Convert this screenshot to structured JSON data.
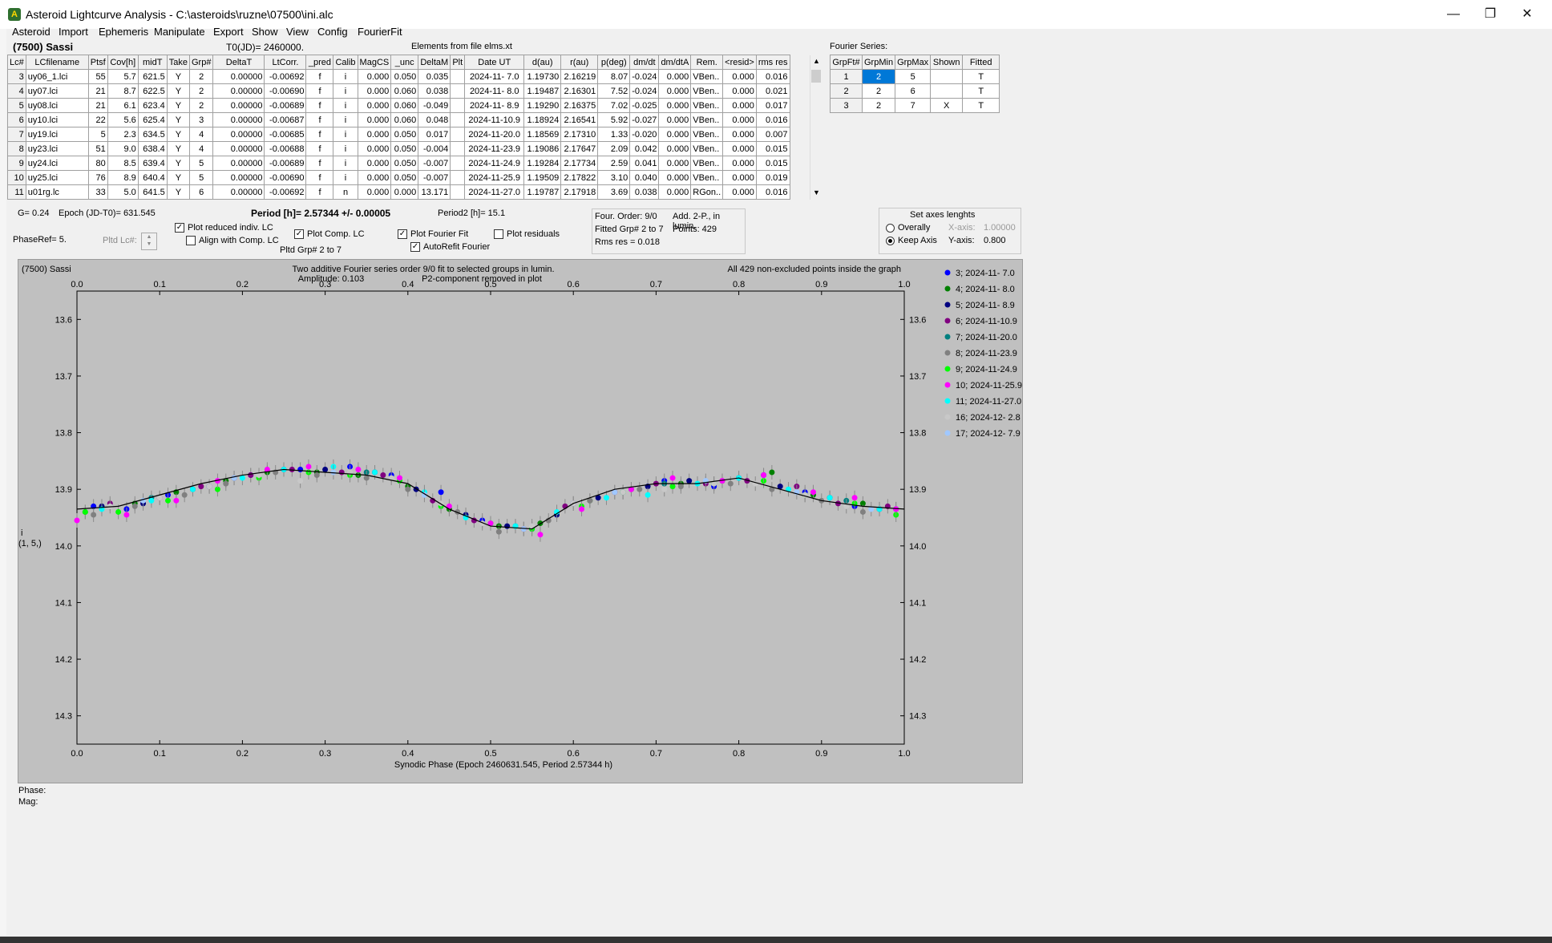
{
  "window": {
    "title": "Asteroid Lightcurve Analysis - C:\\asteroids\\ruzne\\07500\\ini.alc",
    "minimize": "—",
    "restore": "❐",
    "close": "✕"
  },
  "menu": [
    "Asteroid",
    "Import",
    "Ephemeris",
    "Manipulate",
    "Export",
    "Show",
    "View",
    "Config",
    "FourierFit"
  ],
  "header": {
    "asteroid": "(7500) Sassi",
    "t0": "T0(JD)= 2460000.",
    "elements": "Elements from file elms.xt",
    "fourier_series_label": "Fourier Series:"
  },
  "lc_table": {
    "columns": [
      "Lc#",
      "LCfilename",
      "Ptsf",
      "Cov[h]",
      "midT",
      "Take",
      "Grp#",
      "DeltaT",
      "LtCorr.",
      "_pred",
      "Calib",
      "MagCS",
      "_unc",
      "DeltaM",
      "Plt",
      "Date UT",
      "d(au)",
      "r(au)",
      "p(deg)",
      "dm/dt",
      "dm/dtA",
      "Rem.",
      "<resid>",
      "rms res"
    ],
    "rows": [
      [
        "3",
        "uy06_1.lci",
        "55",
        "5.7",
        "621.5",
        "Y",
        "2",
        "0.00000",
        "-0.00692",
        "f",
        "i",
        "0.000",
        "0.050",
        "0.035",
        "",
        "2024-11- 7.0",
        "1.19730",
        "2.16219",
        "8.07",
        "-0.024",
        "0.000",
        "VBen..",
        "0.000",
        "0.016"
      ],
      [
        "4",
        "uy07.lci",
        "21",
        "8.7",
        "622.5",
        "Y",
        "2",
        "0.00000",
        "-0.00690",
        "f",
        "i",
        "0.000",
        "0.060",
        "0.038",
        "",
        "2024-11- 8.0",
        "1.19487",
        "2.16301",
        "7.52",
        "-0.024",
        "0.000",
        "VBen..",
        "0.000",
        "0.021"
      ],
      [
        "5",
        "uy08.lci",
        "21",
        "6.1",
        "623.4",
        "Y",
        "2",
        "0.00000",
        "-0.00689",
        "f",
        "i",
        "0.000",
        "0.060",
        "-0.049",
        "",
        "2024-11- 8.9",
        "1.19290",
        "2.16375",
        "7.02",
        "-0.025",
        "0.000",
        "VBen..",
        "0.000",
        "0.017"
      ],
      [
        "6",
        "uy10.lci",
        "22",
        "5.6",
        "625.4",
        "Y",
        "3",
        "0.00000",
        "-0.00687",
        "f",
        "i",
        "0.000",
        "0.060",
        "0.048",
        "",
        "2024-11-10.9",
        "1.18924",
        "2.16541",
        "5.92",
        "-0.027",
        "0.000",
        "VBen..",
        "0.000",
        "0.016"
      ],
      [
        "7",
        "uy19.lci",
        "5",
        "2.3",
        "634.5",
        "Y",
        "4",
        "0.00000",
        "-0.00685",
        "f",
        "i",
        "0.000",
        "0.050",
        "0.017",
        "",
        "2024-11-20.0",
        "1.18569",
        "2.17310",
        "1.33",
        "-0.020",
        "0.000",
        "VBen..",
        "0.000",
        "0.007"
      ],
      [
        "8",
        "uy23.lci",
        "51",
        "9.0",
        "638.4",
        "Y",
        "4",
        "0.00000",
        "-0.00688",
        "f",
        "i",
        "0.000",
        "0.050",
        "-0.004",
        "",
        "2024-11-23.9",
        "1.19086",
        "2.17647",
        "2.09",
        "0.042",
        "0.000",
        "VBen..",
        "0.000",
        "0.015"
      ],
      [
        "9",
        "uy24.lci",
        "80",
        "8.5",
        "639.4",
        "Y",
        "5",
        "0.00000",
        "-0.00689",
        "f",
        "i",
        "0.000",
        "0.050",
        "-0.007",
        "",
        "2024-11-24.9",
        "1.19284",
        "2.17734",
        "2.59",
        "0.041",
        "0.000",
        "VBen..",
        "0.000",
        "0.015"
      ],
      [
        "10",
        "uy25.lci",
        "76",
        "8.9",
        "640.4",
        "Y",
        "5",
        "0.00000",
        "-0.00690",
        "f",
        "i",
        "0.000",
        "0.050",
        "-0.007",
        "",
        "2024-11-25.9",
        "1.19509",
        "2.17822",
        "3.10",
        "0.040",
        "0.000",
        "VBen..",
        "0.000",
        "0.019"
      ],
      [
        "11",
        "u01rg.lc",
        "33",
        "5.0",
        "641.5",
        "Y",
        "6",
        "0.00000",
        "-0.00692",
        "f",
        "n",
        "0.000",
        "0.000",
        "13.171",
        "",
        "2024-11-27.0",
        "1.19787",
        "2.17918",
        "3.69",
        "0.038",
        "0.000",
        "RGon..",
        "0.000",
        "0.016"
      ]
    ]
  },
  "fourier_table": {
    "columns": [
      "GrpFt#",
      "GrpMin",
      "GrpMax",
      "Shown",
      "Fitted"
    ],
    "rows": [
      [
        "1",
        "2",
        "5",
        "",
        "T"
      ],
      [
        "2",
        "2",
        "6",
        "",
        "T"
      ],
      [
        "3",
        "2",
        "7",
        "X",
        "T"
      ]
    ]
  },
  "controls": {
    "g": "G= 0.24",
    "epoch": "Epoch (JD-T0)= 631.545",
    "period": "Period [h]= 2.57344 +/- 0.00005",
    "period2": "Period2 [h]= 15.1",
    "phaseref": "PhaseRef= 5.",
    "pltd_lc": "Pltd Lc#:",
    "plot_reduced": "Plot reduced indiv. LC",
    "align_comp": "Align with Comp. LC",
    "plot_comp": "Plot Comp. LC",
    "pltd_grp": "Pltd Grp#  2   to   7",
    "plot_fourier": "Plot Fourier Fit",
    "autorefit": "AutoRefit Fourier",
    "plot_residuals": "Plot residuals",
    "four_order": "Four. Order:  9/0",
    "add2p": "Add. 2-P., in lumin.",
    "fitted_grp": "Fitted Grp# 2 to 7",
    "points": "Points: 429",
    "rms": "Rms res      = 0.018",
    "set_axes": "Set axes lenghts",
    "overally": "Overally",
    "keep_axis": "Keep Axis",
    "xaxis_label": "X-axis:",
    "xaxis_value": "1.00000",
    "yaxis_label": "Y-axis:",
    "yaxis_value": "0.800",
    "check": "✓"
  },
  "plot": {
    "name": "(7500) Sassi",
    "title1": "Two additive Fourier series order 9/0 fit to selected groups in lumin.",
    "title2": "Amplitude: 0.103",
    "title3": "P2-component removed in plot",
    "note": "All 429 non-excluded points inside the graph",
    "xlabel": "Synodic Phase (Epoch 2460631.545, Period 2.57344 h)",
    "ylabel1": "i",
    "ylabel2": "(1, 5,)",
    "phase_label": "Phase:",
    "mag_label": "Mag:"
  },
  "chart_data": {
    "type": "scatter",
    "xlim": [
      0.0,
      1.0
    ],
    "ylim": [
      14.35,
      13.55
    ],
    "y_inverted": true,
    "x_ticks": [
      "0.0",
      "0.1",
      "0.2",
      "0.3",
      "0.4",
      "0.5",
      "0.6",
      "0.7",
      "0.8",
      "0.9",
      "1.0"
    ],
    "y_ticks": [
      "13.6",
      "13.7",
      "13.8",
      "13.9",
      "14.0",
      "14.1",
      "14.2",
      "14.3"
    ],
    "grid": false,
    "legend_position": "right-outside",
    "fourier_curve": {
      "x": [
        0.0,
        0.05,
        0.1,
        0.15,
        0.2,
        0.25,
        0.3,
        0.35,
        0.4,
        0.45,
        0.5,
        0.55,
        0.6,
        0.65,
        0.7,
        0.75,
        0.8,
        0.85,
        0.9,
        0.95,
        1.0
      ],
      "y": [
        13.935,
        13.93,
        13.91,
        13.89,
        13.875,
        13.865,
        13.87,
        13.875,
        13.89,
        13.935,
        13.965,
        13.97,
        13.925,
        13.9,
        13.89,
        13.89,
        13.88,
        13.9,
        13.92,
        13.93,
        13.935
      ]
    },
    "series": [
      {
        "name": "3; 2024-11- 7.0",
        "color": "#0000ff",
        "x": [
          0.02,
          0.06,
          0.11,
          0.16,
          0.21,
          0.27,
          0.33,
          0.38,
          0.44,
          0.49,
          0.55,
          0.6,
          0.66,
          0.71,
          0.77,
          0.83,
          0.88,
          0.94,
          0.99
        ],
        "y": [
          13.93,
          13.935,
          13.91,
          13.895,
          13.875,
          13.865,
          13.86,
          13.875,
          13.905,
          13.955,
          13.97,
          13.925,
          13.905,
          13.885,
          13.895,
          13.875,
          13.905,
          13.93,
          13.935
        ]
      },
      {
        "name": "4; 2024-11- 8.0",
        "color": "#008000",
        "x": [
          0.01,
          0.07,
          0.12,
          0.18,
          0.23,
          0.29,
          0.34,
          0.4,
          0.45,
          0.51,
          0.56,
          0.62,
          0.67,
          0.73,
          0.78,
          0.84,
          0.89,
          0.95
        ],
        "y": [
          13.94,
          13.925,
          13.905,
          13.885,
          13.87,
          13.87,
          13.875,
          13.895,
          13.935,
          13.965,
          13.96,
          13.92,
          13.9,
          13.89,
          13.885,
          13.87,
          13.91,
          13.925
        ]
      },
      {
        "name": "5; 2024-11- 8.9",
        "color": "#000080",
        "x": [
          0.03,
          0.08,
          0.14,
          0.19,
          0.25,
          0.3,
          0.36,
          0.41,
          0.47,
          0.52,
          0.58,
          0.63,
          0.69,
          0.74,
          0.8,
          0.85,
          0.91,
          0.97
        ],
        "y": [
          13.93,
          13.925,
          13.9,
          13.88,
          13.865,
          13.865,
          13.87,
          13.9,
          13.945,
          13.965,
          13.945,
          13.915,
          13.895,
          13.885,
          13.88,
          13.895,
          13.915,
          13.935
        ]
      },
      {
        "name": "6; 2024-11-10.9",
        "color": "#800080",
        "x": [
          0.04,
          0.1,
          0.15,
          0.21,
          0.26,
          0.32,
          0.37,
          0.43,
          0.48,
          0.54,
          0.59,
          0.65,
          0.7,
          0.76,
          0.81,
          0.87,
          0.92,
          0.98
        ],
        "y": [
          13.925,
          13.915,
          13.895,
          13.875,
          13.865,
          13.87,
          13.875,
          13.92,
          13.955,
          13.97,
          13.93,
          13.905,
          13.89,
          13.89,
          13.885,
          13.895,
          13.925,
          13.93
        ]
      },
      {
        "name": "7; 2024-11-20.0",
        "color": "#008080",
        "x": [
          0.09,
          0.35,
          0.53,
          0.71,
          0.93
        ],
        "y": [
          13.915,
          13.87,
          13.965,
          13.89,
          13.92
        ]
      },
      {
        "name": "8; 2024-11-23.9",
        "color": "#808080",
        "x": [
          0.02,
          0.07,
          0.13,
          0.18,
          0.24,
          0.29,
          0.35,
          0.4,
          0.46,
          0.51,
          0.57,
          0.62,
          0.68,
          0.73,
          0.79,
          0.84,
          0.9,
          0.95
        ],
        "y": [
          13.945,
          13.93,
          13.91,
          13.89,
          13.87,
          13.875,
          13.88,
          13.9,
          13.94,
          13.975,
          13.955,
          13.92,
          13.9,
          13.895,
          13.89,
          13.9,
          13.92,
          13.94
        ]
      },
      {
        "name": "9; 2024-11-24.9",
        "color": "#00ff00",
        "x": [
          0.01,
          0.05,
          0.11,
          0.17,
          0.22,
          0.28,
          0.33,
          0.39,
          0.44,
          0.5,
          0.55,
          0.61,
          0.66,
          0.72,
          0.77,
          0.83,
          0.88,
          0.94,
          0.99
        ],
        "y": [
          13.94,
          13.94,
          13.92,
          13.9,
          13.88,
          13.87,
          13.875,
          13.885,
          13.93,
          13.96,
          13.97,
          13.93,
          13.905,
          13.895,
          13.89,
          13.885,
          13.91,
          13.925,
          13.945
        ]
      },
      {
        "name": "10; 2024-11-25.9",
        "color": "#ff00ff",
        "x": [
          0.0,
          0.06,
          0.12,
          0.17,
          0.23,
          0.28,
          0.34,
          0.39,
          0.45,
          0.5,
          0.56,
          0.61,
          0.67,
          0.72,
          0.78,
          0.83,
          0.89,
          0.94,
          0.99
        ],
        "y": [
          13.955,
          13.945,
          13.92,
          13.885,
          13.865,
          13.86,
          13.865,
          13.88,
          13.93,
          13.96,
          13.98,
          13.935,
          13.9,
          13.88,
          13.885,
          13.875,
          13.905,
          13.915,
          13.935
        ]
      },
      {
        "name": "11; 2024-11-27.0",
        "color": "#00ffff",
        "x": [
          0.03,
          0.09,
          0.14,
          0.2,
          0.25,
          0.31,
          0.36,
          0.42,
          0.47,
          0.53,
          0.58,
          0.64,
          0.69,
          0.75,
          0.8,
          0.86,
          0.91,
          0.97
        ],
        "y": [
          13.935,
          13.92,
          13.9,
          13.88,
          13.865,
          13.86,
          13.87,
          13.905,
          13.95,
          13.965,
          13.94,
          13.915,
          13.91,
          13.89,
          13.88,
          13.9,
          13.915,
          13.935
        ]
      },
      {
        "name": "16; 2024-12- 2.8",
        "color": "#c8c8c8",
        "x": [
          0.04,
          0.1,
          0.16,
          0.22,
          0.27,
          0.33,
          0.38,
          0.44,
          0.49,
          0.55,
          0.6,
          0.66,
          0.71,
          0.77,
          0.82,
          0.88,
          0.93
        ],
        "y": [
          13.93,
          13.915,
          13.895,
          13.875,
          13.885,
          13.87,
          13.88,
          13.925,
          13.96,
          13.965,
          13.925,
          13.905,
          13.9,
          13.89,
          13.89,
          13.91,
          13.93
        ]
      },
      {
        "name": "17; 2024-12- 7.9",
        "color": "#a0c8ff",
        "x": [
          0.08,
          0.19,
          0.31,
          0.42,
          0.54,
          0.65,
          0.76,
          0.87,
          0.96
        ],
        "y": [
          13.92,
          13.88,
          13.87,
          13.91,
          13.97,
          13.905,
          13.885,
          13.905,
          13.935
        ]
      }
    ]
  }
}
